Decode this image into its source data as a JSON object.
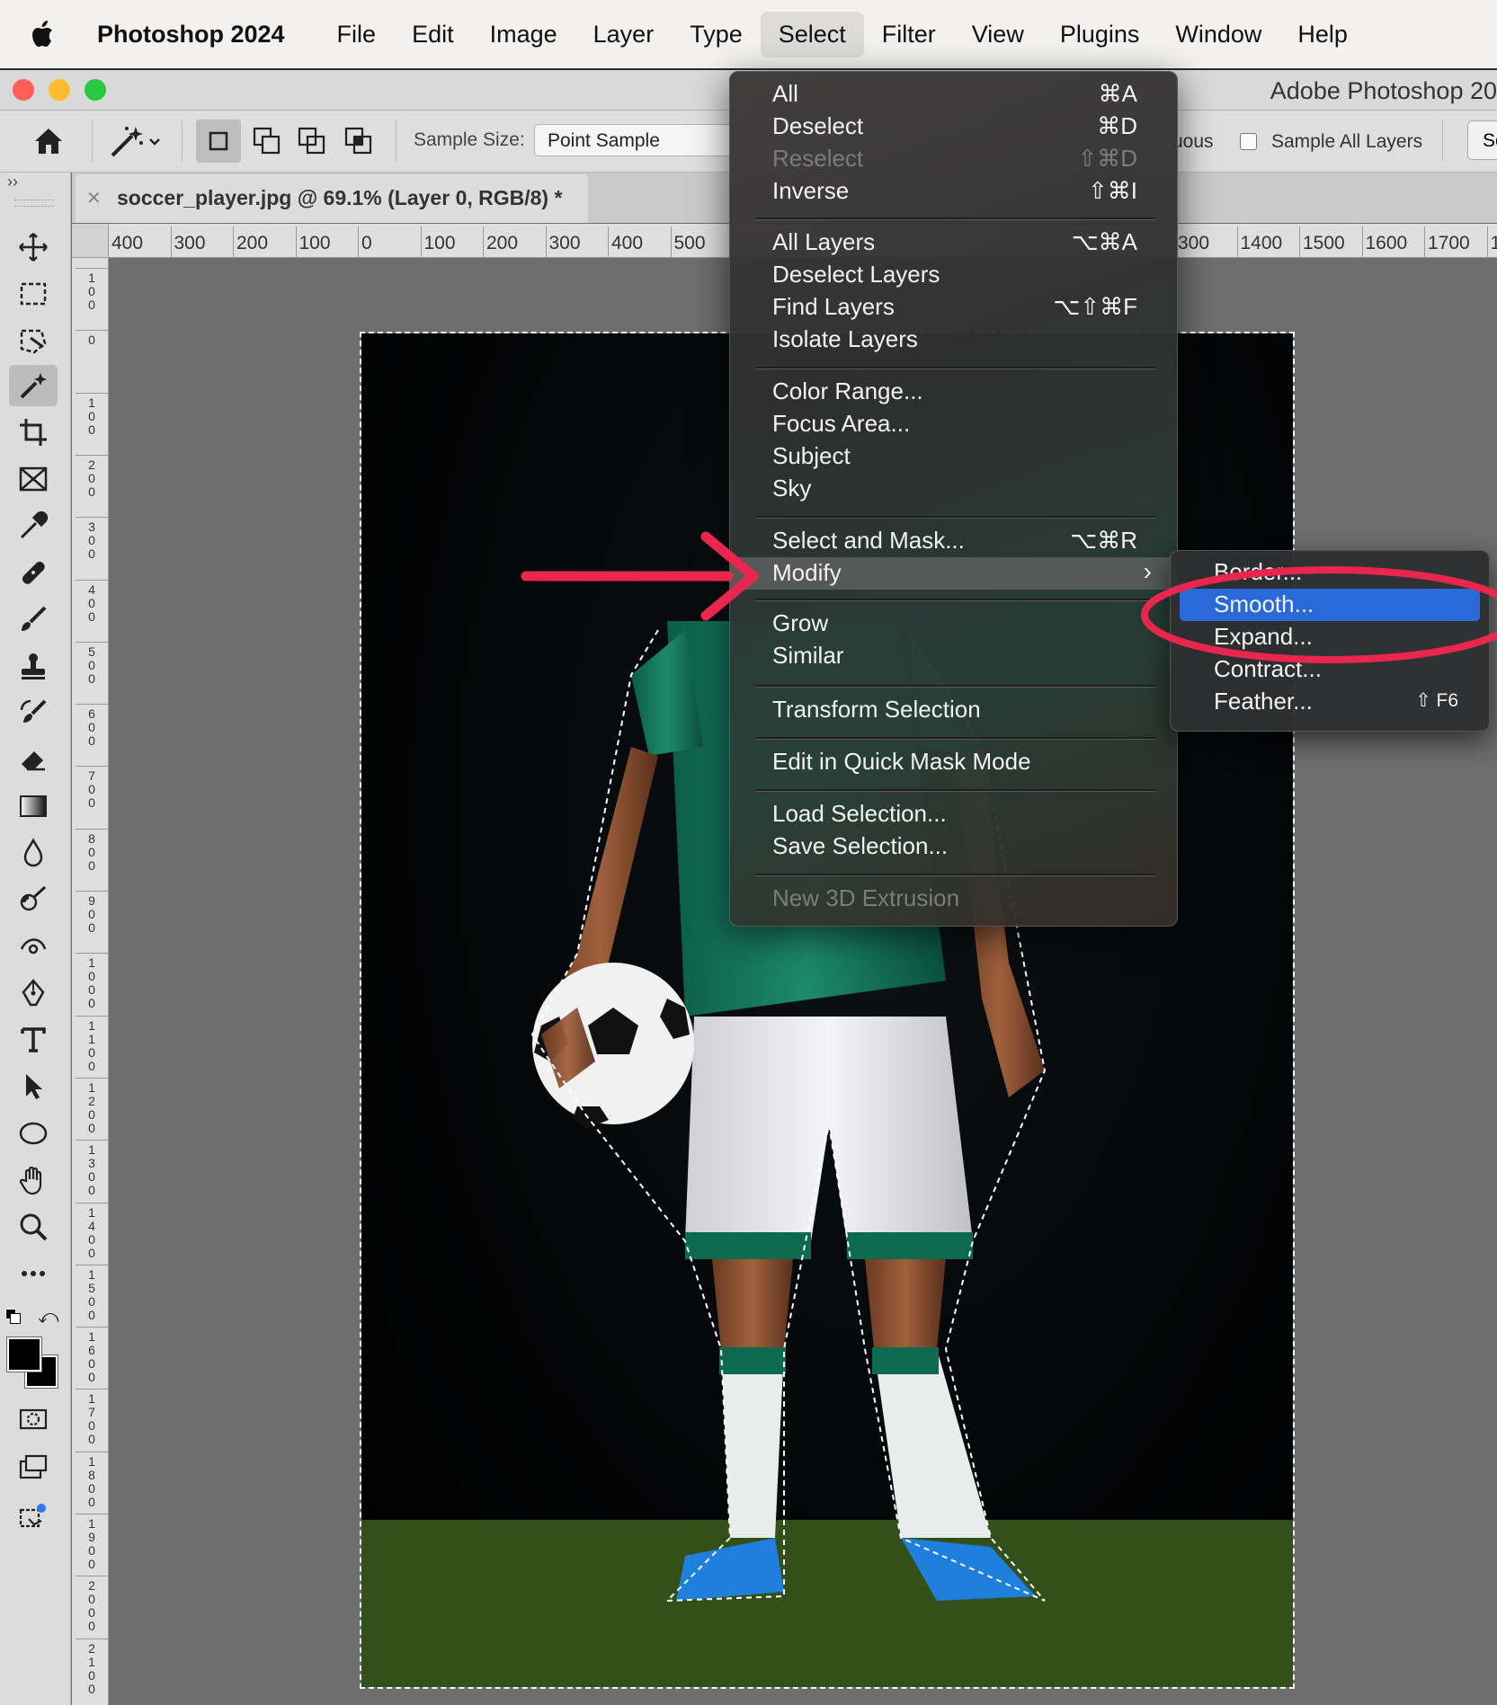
{
  "menubar": {
    "app_name": "Photoshop 2024",
    "items": [
      "File",
      "Edit",
      "Image",
      "Layer",
      "Type",
      "Select",
      "Filter",
      "View",
      "Plugins",
      "Window",
      "Help"
    ],
    "active_item": "Select"
  },
  "window": {
    "title": "Adobe Photoshop 20",
    "traffic_colors": [
      "#ff5f57",
      "#febc2e",
      "#28c840"
    ]
  },
  "options_bar": {
    "sample_size_label": "Sample Size:",
    "sample_size_value": "Point Sample",
    "contiguous_label": "uous",
    "sample_all_layers_label": "Sample All Layers",
    "sample_all_layers_checked": false,
    "right_button_label": "Se"
  },
  "document": {
    "tab_title": "soccer_player.jpg @ 69.1% (Layer 0, RGB/8) *",
    "ruler_h_labels_left": [
      "400",
      "300",
      "200",
      "100",
      "0",
      "100",
      "200",
      "300",
      "400",
      "500"
    ],
    "ruler_h_labels_right": [
      "300",
      "1400",
      "1500",
      "1600",
      "1700",
      "18"
    ],
    "ruler_v_labels": [
      "100",
      "0",
      "100",
      "200",
      "300",
      "400",
      "500",
      "600",
      "700",
      "800",
      "900",
      "1000",
      "1100",
      "1200",
      "1300",
      "1400",
      "1500",
      "1600",
      "1700",
      "1800",
      "1900",
      "2000",
      "2100"
    ]
  },
  "toolbar": {
    "tools": [
      "move-tool",
      "marquee-tool",
      "lasso-tool",
      "magic-wand-tool",
      "crop-tool",
      "frame-tool",
      "eyedropper-tool",
      "healing-brush-tool",
      "brush-tool",
      "clone-stamp-tool",
      "history-brush-tool",
      "eraser-tool",
      "gradient-tool",
      "blur-tool",
      "dodge-tool",
      "smudge-tool",
      "pen-tool",
      "type-tool",
      "path-selection-tool",
      "ellipse-tool",
      "hand-tool",
      "zoom-tool",
      "more-tools",
      "swap-colors",
      "quick-mask",
      "screen-mode",
      "generative"
    ],
    "active_tool": "magic-wand-tool",
    "foreground_color": "#000000",
    "background_color": "#000000"
  },
  "select_menu": {
    "items": [
      {
        "label": "All",
        "shortcut": "⌘A"
      },
      {
        "label": "Deselect",
        "shortcut": "⌘D"
      },
      {
        "label": "Reselect",
        "shortcut": "⇧⌘D",
        "disabled": true
      },
      {
        "label": "Inverse",
        "shortcut": "⇧⌘I"
      },
      {
        "label": "All Layers",
        "shortcut": "⌥⌘A"
      },
      {
        "label": "Deselect Layers",
        "shortcut": ""
      },
      {
        "label": "Find Layers",
        "shortcut": "⌥⇧⌘F"
      },
      {
        "label": "Isolate Layers",
        "shortcut": ""
      },
      {
        "label": "Color Range...",
        "shortcut": ""
      },
      {
        "label": "Focus Area...",
        "shortcut": ""
      },
      {
        "label": "Subject",
        "shortcut": ""
      },
      {
        "label": "Sky",
        "shortcut": ""
      },
      {
        "label": "Select and Mask...",
        "shortcut": "⌥⌘R"
      },
      {
        "label": "Modify",
        "shortcut": "",
        "submenu": true,
        "highlighted": true
      },
      {
        "label": "Grow",
        "shortcut": ""
      },
      {
        "label": "Similar",
        "shortcut": ""
      },
      {
        "label": "Transform Selection",
        "shortcut": ""
      },
      {
        "label": "Edit in Quick Mask Mode",
        "shortcut": ""
      },
      {
        "label": "Load Selection...",
        "shortcut": ""
      },
      {
        "label": "Save Selection...",
        "shortcut": ""
      },
      {
        "label": "New 3D Extrusion",
        "shortcut": "",
        "disabled": true
      }
    ]
  },
  "modify_submenu": {
    "items": [
      {
        "label": "Border...",
        "shortcut": ""
      },
      {
        "label": "Smooth...",
        "shortcut": "",
        "selected": true
      },
      {
        "label": "Expand...",
        "shortcut": ""
      },
      {
        "label": "Contract...",
        "shortcut": ""
      },
      {
        "label": "Feather...",
        "shortcut": "⇧ F6"
      }
    ]
  },
  "annotations": {
    "arrow_color": "#e8264e",
    "circle_color": "#e8264e"
  },
  "icons": {
    "apple": "apple-logo-icon",
    "home": "home-icon",
    "magic_wand": "magic-wand-icon",
    "chevron": "chevron-right-icon"
  }
}
